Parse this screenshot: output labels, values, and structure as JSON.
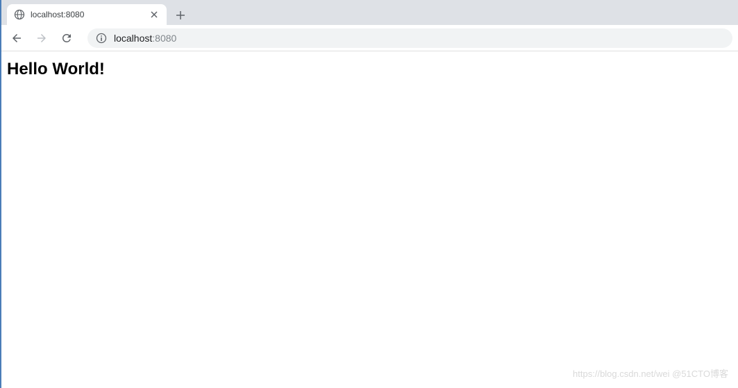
{
  "tab": {
    "title": "localhost:8080"
  },
  "address": {
    "host": "localhost",
    "port": ":8080"
  },
  "page": {
    "heading": "Hello World!"
  },
  "watermark": "https://blog.csdn.net/wei @51CTO博客"
}
